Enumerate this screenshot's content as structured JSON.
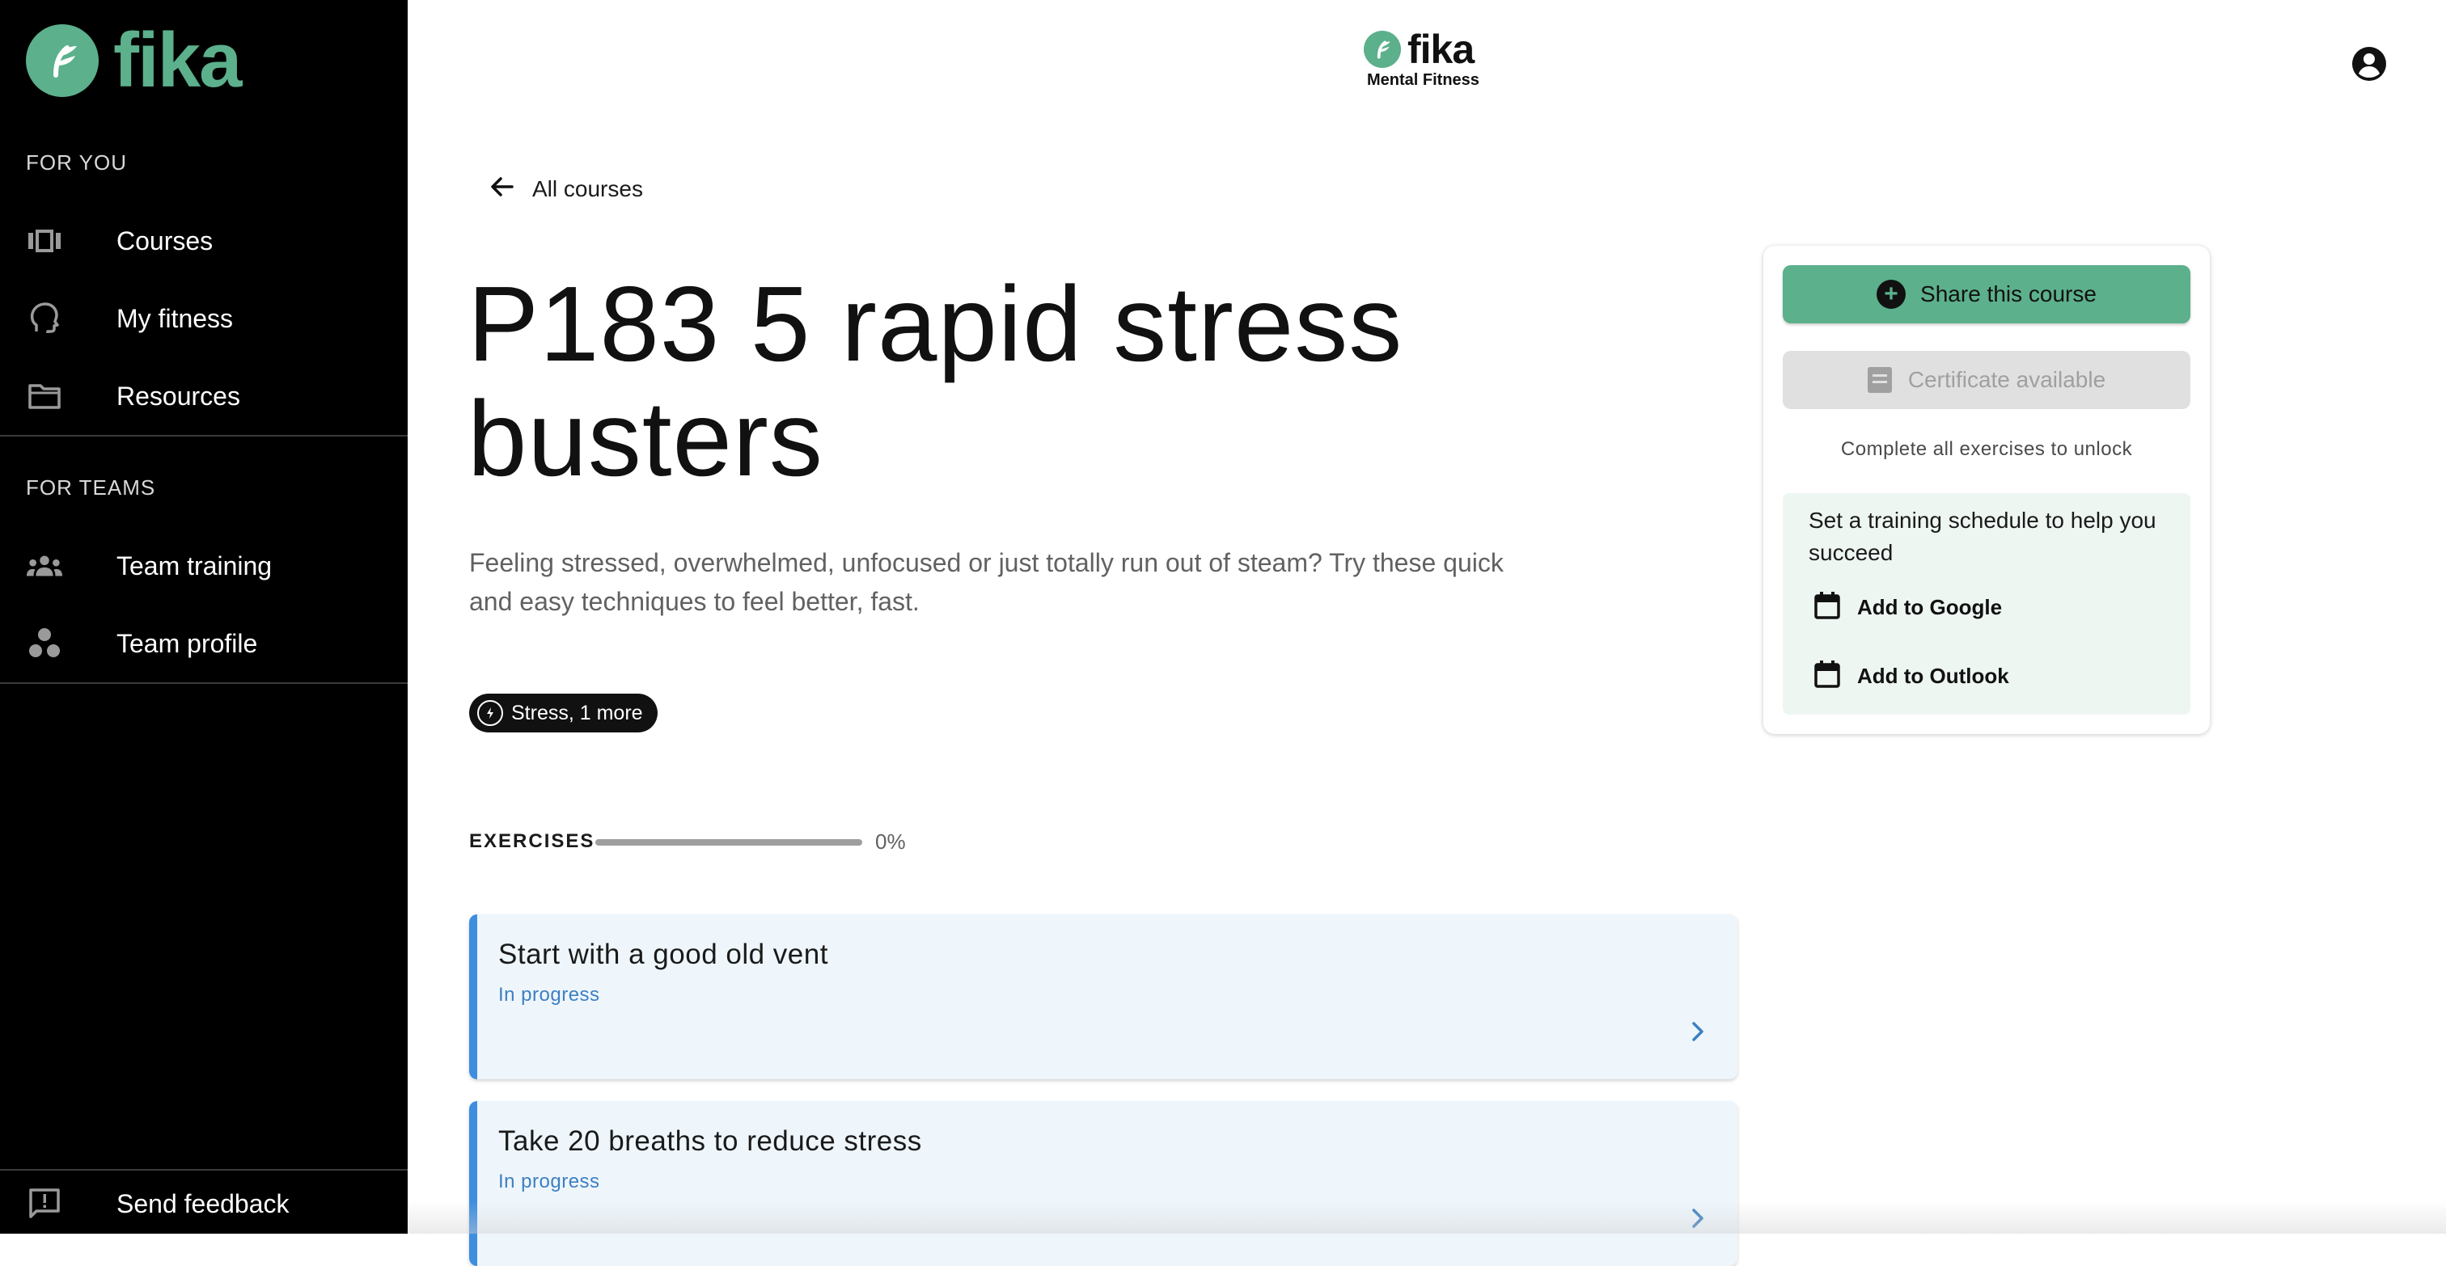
{
  "sidebar": {
    "brand": "fika",
    "sections": [
      {
        "label": "FOR YOU",
        "items": [
          {
            "label": "Courses",
            "icon": "courses-icon"
          },
          {
            "label": "My fitness",
            "icon": "head-icon"
          },
          {
            "label": "Resources",
            "icon": "folder-icon"
          }
        ]
      },
      {
        "label": "FOR TEAMS",
        "items": [
          {
            "label": "Team training",
            "icon": "people-icon"
          },
          {
            "label": "Team profile",
            "icon": "team-profile-icon"
          }
        ]
      }
    ],
    "feedback": {
      "label": "Send feedback",
      "icon": "feedback-icon"
    }
  },
  "header": {
    "brand": "fika",
    "tagline": "Mental Fitness",
    "account_icon": "account-circle-icon"
  },
  "main": {
    "back_label": "All courses",
    "title": "P183 5 rapid stress busters",
    "description": "Feeling stressed, overwhelmed, unfocused or just totally run out of steam? Try these quick and easy techniques to feel better, fast.",
    "tag": "Stress, 1 more",
    "exercises_label": "EXERCISES",
    "progress_fraction": 0,
    "progress_text": "0%",
    "exercises": [
      {
        "title": "Start with a good old vent",
        "status": "In progress"
      },
      {
        "title": "Take 20 breaths to reduce stress",
        "status": "In progress"
      }
    ]
  },
  "panel": {
    "share_label": "Share this course",
    "certificate_label": "Certificate available",
    "unlock_note": "Complete all exercises to unlock",
    "schedule_text": "Set a training schedule to help you succeed",
    "add_google": "Add to Google",
    "add_outlook": "Add to Outlook"
  },
  "colors": {
    "brand_green": "#5cb08c",
    "sidebar_bg": "#000000",
    "exercise_accent": "#3e8ee0",
    "exercise_bg": "#eef6fc",
    "schedule_bg": "#eef6f2"
  }
}
